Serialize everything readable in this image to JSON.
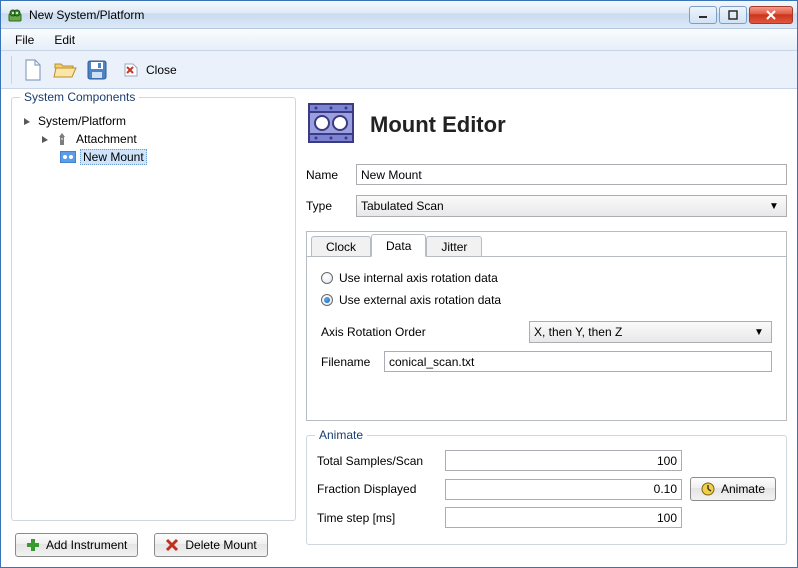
{
  "window": {
    "title": "New System/Platform"
  },
  "menubar": {
    "file": "File",
    "edit": "Edit"
  },
  "toolbar": {
    "close": "Close"
  },
  "left": {
    "group_title": "System Components",
    "tree": {
      "root": "System/Platform",
      "attachment": "Attachment",
      "mount": "New Mount"
    },
    "add_btn": "Add Instrument",
    "delete_btn": "Delete Mount"
  },
  "editor": {
    "title": "Mount Editor",
    "name_label": "Name",
    "name_value": "New Mount",
    "type_label": "Type",
    "type_value": "Tabulated Scan",
    "tabs": {
      "clock": "Clock",
      "data": "Data",
      "jitter": "Jitter"
    },
    "radio_internal": "Use internal axis rotation data",
    "radio_external": "Use external axis rotation data",
    "axis_order_label": "Axis Rotation Order",
    "axis_order_value": "X, then Y, then Z",
    "filename_label": "Filename",
    "filename_value": "conical_scan.txt"
  },
  "animate": {
    "title": "Animate",
    "total_label": "Total Samples/Scan",
    "total_value": "100",
    "fraction_label": "Fraction Displayed",
    "fraction_value": "0.10",
    "timestep_label": "Time step [ms]",
    "timestep_value": "100",
    "button": "Animate"
  }
}
